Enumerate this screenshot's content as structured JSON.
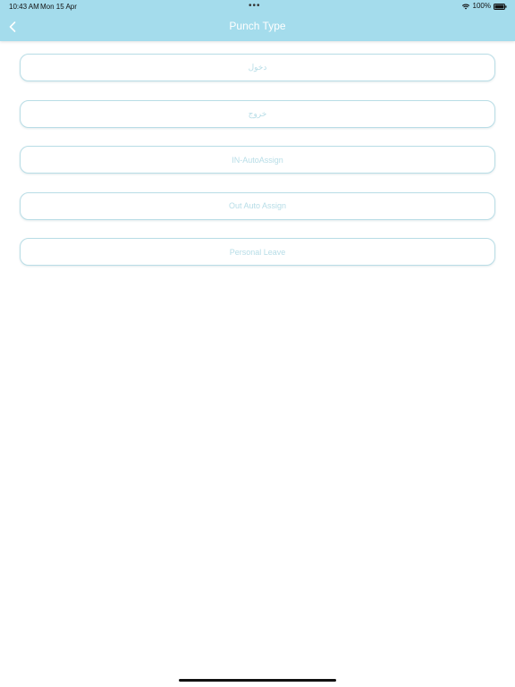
{
  "status_bar": {
    "time": "10:43 AM",
    "date": "Mon 15 Apr",
    "center_dots": "•••",
    "battery_percent": "100%",
    "battery_level": 1.0,
    "icons": [
      "wifi-icon",
      "battery-icon"
    ]
  },
  "header": {
    "title": "Punch Type",
    "back_icon": "back-chevron-icon",
    "background_color": "#a4dcec"
  },
  "options": [
    {
      "label": "دخول"
    },
    {
      "label": "خروج"
    },
    {
      "label": "IN-AutoAssign"
    },
    {
      "label": "Out Auto Assign"
    },
    {
      "label": "Personal Leave"
    }
  ],
  "colors": {
    "header": "#a4dcec",
    "option_border": "#b9dde6",
    "option_text": "#b7dde7",
    "background": "#ffffff"
  }
}
